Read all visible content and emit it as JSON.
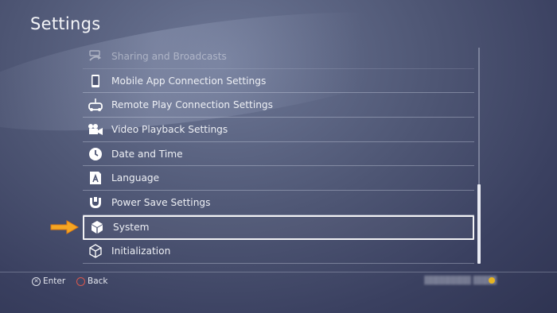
{
  "header": {
    "title": "Settings"
  },
  "menu": {
    "items": [
      {
        "label": "Sharing and Broadcasts",
        "icon": "share-icon",
        "state": "faded"
      },
      {
        "label": "Mobile App Connection Settings",
        "icon": "mobile-phone-icon"
      },
      {
        "label": "Remote Play Connection Settings",
        "icon": "remote-play-icon"
      },
      {
        "label": "Video Playback Settings",
        "icon": "video-camera-icon"
      },
      {
        "label": "Date and Time",
        "icon": "clock-icon"
      },
      {
        "label": "Language",
        "icon": "language-icon"
      },
      {
        "label": "Power Save Settings",
        "icon": "power-save-icon"
      },
      {
        "label": "System",
        "icon": "cube-icon",
        "state": "selected"
      },
      {
        "label": "Initialization",
        "icon": "cube-outline-icon"
      }
    ]
  },
  "footer": {
    "enter_label": "Enter",
    "back_label": "Back"
  },
  "colors": {
    "pointer_arrow": "#f5a623",
    "back_button_ring": "#d9584d",
    "user_indicator": "#e6b422"
  }
}
